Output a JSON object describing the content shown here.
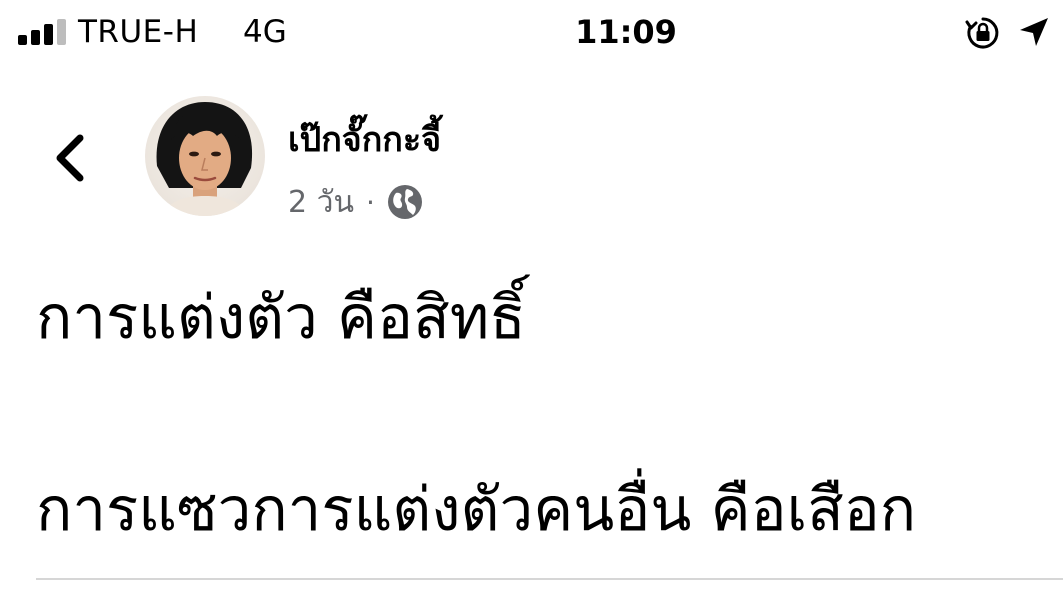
{
  "status_bar": {
    "carrier": "TRUE-H",
    "network": "4G",
    "time": "11:09",
    "signal_bars_filled": 3,
    "signal_bars_total": 4,
    "icons": [
      "orientation-lock-icon",
      "location-arrow-icon"
    ]
  },
  "post": {
    "author": "เป๊กจั๊กกะจี้",
    "time_ago": "2 วัน",
    "separator": "·",
    "privacy_icon": "globe-icon",
    "lines": [
      "การแต่งตัว คือสิทธิ์",
      "การแซวการแต่งตัวคนอื่น คือเสือก"
    ]
  },
  "colors": {
    "text": "#000000",
    "meta_text": "#65676b",
    "divider": "#d6d6d6"
  }
}
